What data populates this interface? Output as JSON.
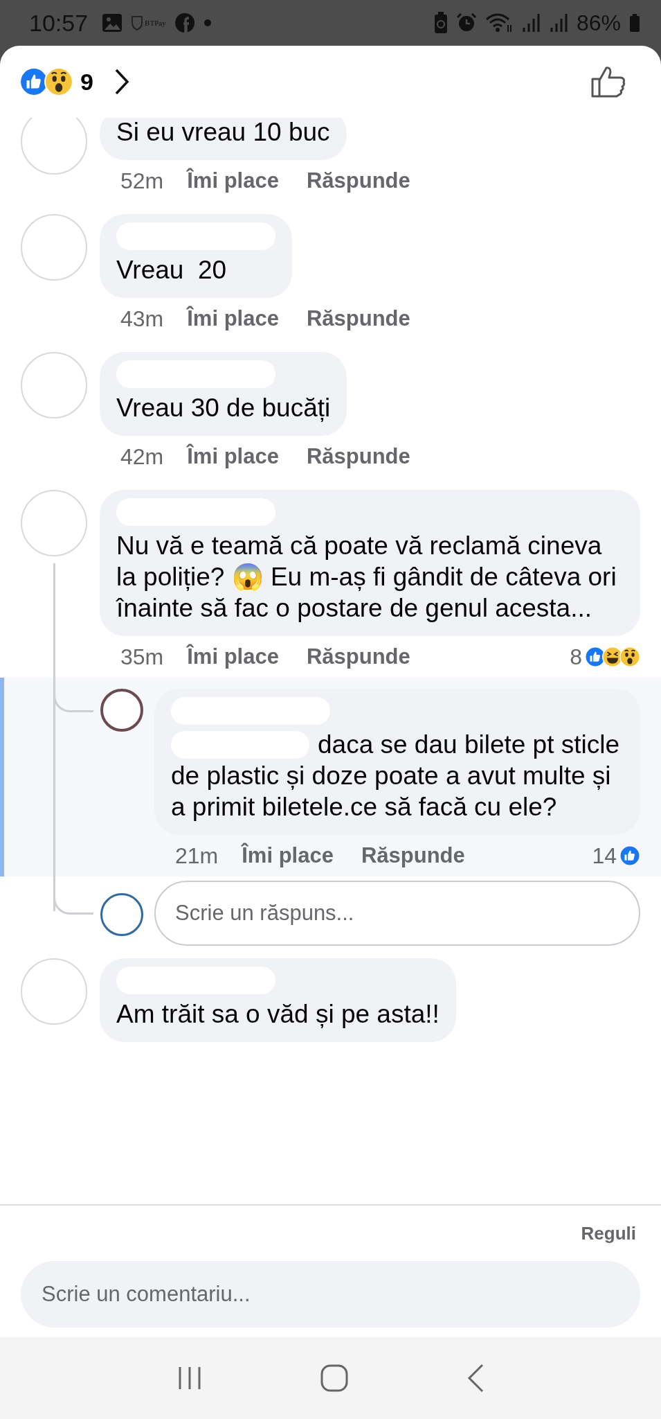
{
  "status_bar": {
    "time": "10:57",
    "notification_label": "BTPay",
    "battery": "86%"
  },
  "header": {
    "reaction_count": "9",
    "reactions": [
      {
        "kind": "like"
      },
      {
        "kind": "wow"
      }
    ]
  },
  "comments": [
    {
      "name_redacted": false,
      "text": "Si eu vreau 10 buc",
      "time": "52m",
      "like_label": "Îmi place",
      "reply_label": "Răspunde"
    },
    {
      "name_redacted": true,
      "text": "Vreau  20",
      "time": "43m",
      "like_label": "Îmi place",
      "reply_label": "Răspunde"
    },
    {
      "name_redacted": true,
      "text": "Vreau 30 de bucăți",
      "time": "42m",
      "like_label": "Îmi place",
      "reply_label": "Răspunde"
    },
    {
      "name_redacted": true,
      "text": "Nu vă e teamă că poate vă reclamă cineva la poliție? 😱 Eu m-aș fi gândit de câteva ori înainte să fac o postare de genul acesta...",
      "time": "35m",
      "like_label": "Îmi place",
      "reply_label": "Răspunde",
      "reaction_count": "8",
      "reactions": [
        {
          "kind": "like"
        },
        {
          "kind": "haha"
        },
        {
          "kind": "wow"
        }
      ],
      "replies": [
        {
          "name_redacted": true,
          "mention_redacted": true,
          "highlighted": true,
          "text": "daca se dau bilete pt sticle de plastic și doze poate a avut multe și a primit biletele.ce să facă cu ele?",
          "time": "21m",
          "like_label": "Îmi place",
          "reply_label": "Răspunde",
          "reaction_count": "14",
          "reactions": [
            {
              "kind": "like"
            }
          ]
        }
      ],
      "reply_field": {
        "placeholder": "Scrie un răspuns..."
      }
    },
    {
      "name_redacted": true,
      "text": "Am trăit sa o văd și pe asta!!"
    }
  ],
  "footer": {
    "rules_link": "Reguli",
    "comment_field": {
      "placeholder": "Scrie un comentariu..."
    }
  }
}
